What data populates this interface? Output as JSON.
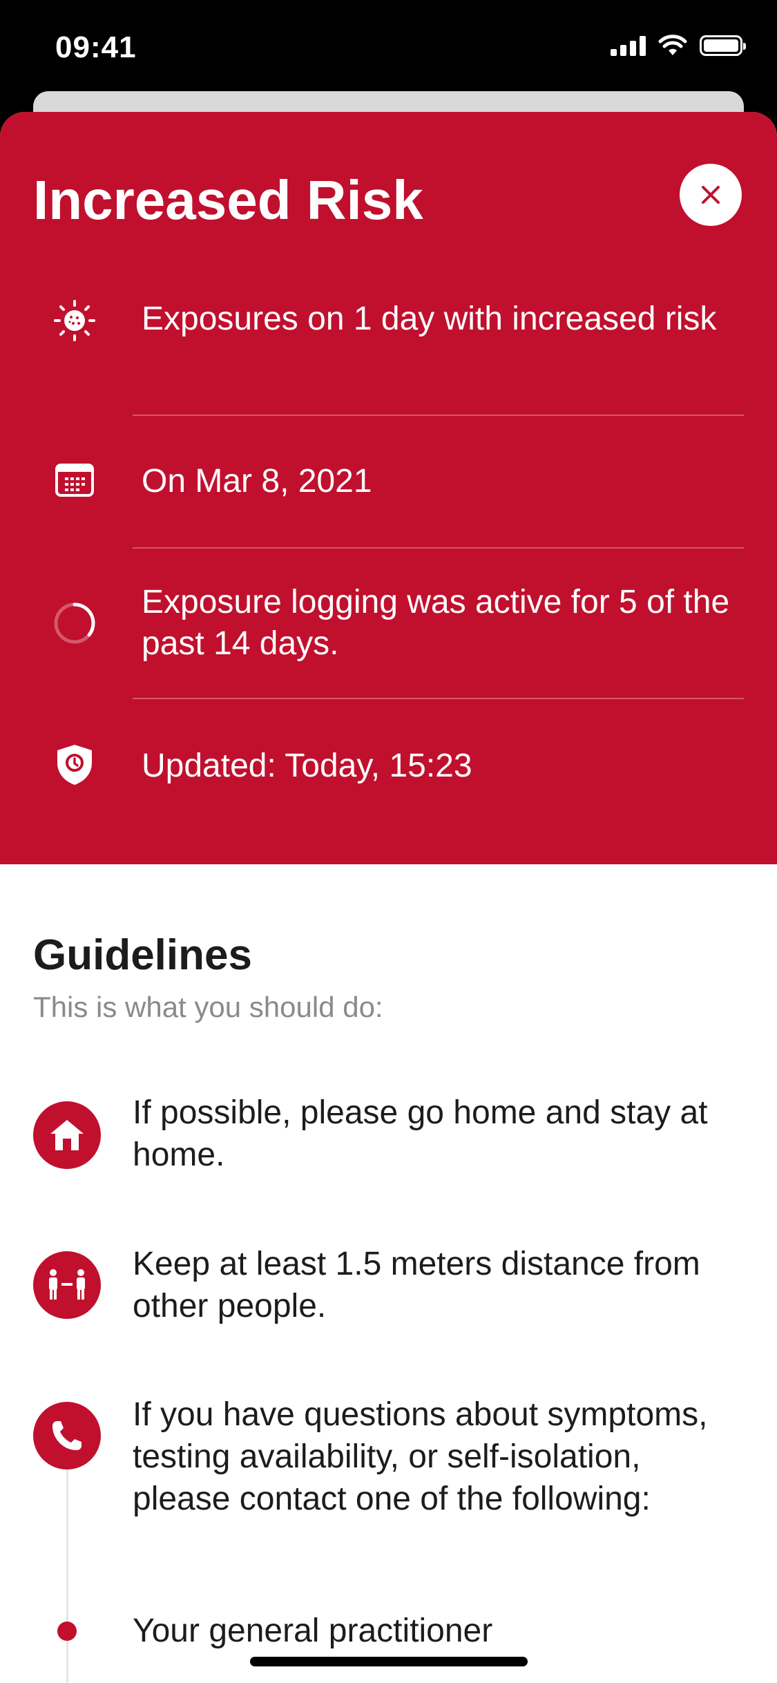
{
  "status_bar": {
    "time": "09:41"
  },
  "risk": {
    "title": "Increased Risk",
    "rows": [
      {
        "icon": "virus-icon",
        "text": "Exposures on 1 day with increased risk"
      },
      {
        "icon": "calendar-icon",
        "text": "On Mar 8, 2021"
      },
      {
        "icon": "progress-ring-icon",
        "text": "Exposure logging was active for 5 of the past 14 days.",
        "progress": 0.357
      },
      {
        "icon": "shield-clock-icon",
        "text": "Updated: Today, 15:23"
      }
    ]
  },
  "guidelines": {
    "title": "Guidelines",
    "subtitle": "This is what you should do:",
    "items": [
      {
        "icon": "home-icon",
        "text": "If possible, please go home and stay at home."
      },
      {
        "icon": "distance-icon",
        "text": "Keep at least 1.5 meters distance from other people."
      },
      {
        "icon": "phone-icon",
        "text": "If you have questions about symptoms, testing availability, or self-isolation, please contact one of the following:"
      }
    ],
    "contacts": [
      "Your general practitioner"
    ]
  },
  "colors": {
    "accent": "#c0102e",
    "text": "#1c1c1e",
    "secondary": "#8a8a8e"
  }
}
